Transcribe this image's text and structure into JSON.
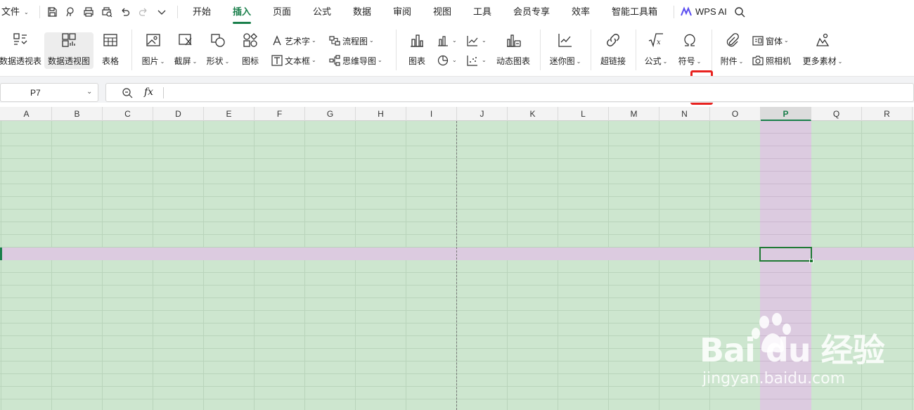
{
  "menubar": {
    "file": "文件",
    "tabs": [
      {
        "label": "开始"
      },
      {
        "label": "插入",
        "active": true
      },
      {
        "label": "页面"
      },
      {
        "label": "公式"
      },
      {
        "label": "数据"
      },
      {
        "label": "审阅"
      },
      {
        "label": "视图"
      },
      {
        "label": "工具"
      },
      {
        "label": "会员专享"
      },
      {
        "label": "效率"
      },
      {
        "label": "智能工具箱"
      }
    ],
    "ai_label": "WPS AI"
  },
  "ribbon": {
    "pivot_table": "数据透视表",
    "pivot_chart": "数据透视图",
    "table": "表格",
    "picture": "图片",
    "screenshot": "截屏",
    "shape": "形状",
    "icon": "图标",
    "wordart": "艺术字",
    "textbox": "文本框",
    "flowchart": "流程图",
    "mindmap": "思维导图",
    "chart": "图表",
    "dynamic_chart": "动态图表",
    "sparkline": "迷你图",
    "hyperlink": "超链接",
    "formula": "公式",
    "symbol": "符号",
    "attachment": "附件",
    "form": "窗体",
    "camera": "照相机",
    "more_material": "更多素材"
  },
  "formula_bar": {
    "cell_ref": "P7",
    "fx": "fx",
    "value": ""
  },
  "sheet": {
    "columns": [
      "A",
      "B",
      "C",
      "D",
      "E",
      "F",
      "G",
      "H",
      "I",
      "J",
      "K",
      "L",
      "M",
      "N",
      "O",
      "P",
      "Q",
      "R"
    ],
    "selected_column": "P",
    "selected_row": 7,
    "grid_color": "#cde6cf",
    "highlight_color": "#dccbe0"
  },
  "watermark": {
    "brand": "Bai  du 经验",
    "url": "jingyan.baidu.com"
  },
  "colors": {
    "accent": "#1a7f4b",
    "annotation": "#e8221f"
  }
}
